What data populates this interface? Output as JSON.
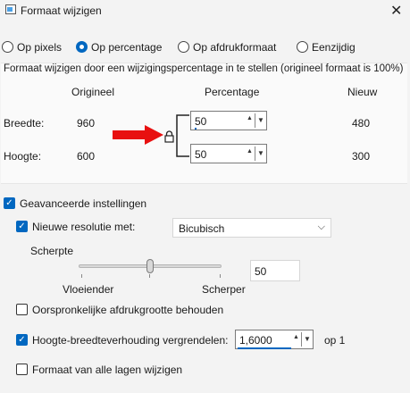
{
  "window": {
    "title": "Formaat wijzigen",
    "close": "✕"
  },
  "mode": {
    "options": [
      "Op pixels",
      "Op percentage",
      "Op afdrukformaat",
      "Eenzijdig"
    ],
    "selected": "Op percentage"
  },
  "description": "Formaat wijzigen door een wijzigingspercentage in te stellen (origineel formaat  is 100%)",
  "table": {
    "headers": {
      "original": "Origineel",
      "percentage": "Percentage",
      "new": "Nieuw"
    },
    "rows": [
      {
        "label": "Breedte:",
        "original": "960",
        "percentage": "50",
        "new": "480"
      },
      {
        "label": "Hoogte:",
        "original": "600",
        "percentage": "50",
        "new": "300"
      }
    ]
  },
  "advanced": {
    "label": "Geavanceerde instellingen",
    "checked": true,
    "resample": {
      "label": "Nieuwe resolutie met:",
      "checked": true,
      "method": "Bicubisch"
    },
    "sharpness": {
      "label": "Scherpte",
      "min_label": "Vloeiender",
      "max_label": "Scherper",
      "value": "50"
    },
    "keep_print_size": {
      "label": "Oorspronkelijke afdrukgrootte behouden",
      "checked": false
    },
    "lock_aspect": {
      "label": "Hoogte-breedteverhouding vergrendelen:",
      "checked": true,
      "value": "1,6000",
      "suffix": "op 1"
    },
    "resize_all_layers": {
      "label": "Formaat van alle lagen wijzigen",
      "checked": false
    }
  },
  "colors": {
    "accent": "#0067c0",
    "arrow": "#e81010"
  },
  "icons": {
    "lock": "lock-icon",
    "arrow": "arrow-right-icon",
    "spin_up": "▲",
    "spin_down": "▼",
    "dropdown": "⌵"
  }
}
